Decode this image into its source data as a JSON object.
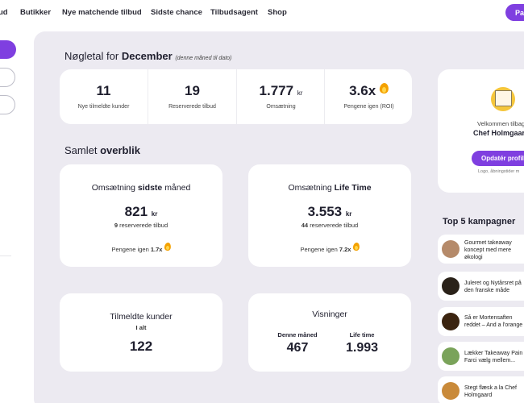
{
  "nav": {
    "items": [
      "ud",
      "Butikker",
      "Nye matchende tilbud",
      "Sidste chance",
      "Tilbudsagent",
      "Shop"
    ],
    "cta_label": "Pa"
  },
  "kpi": {
    "title_prefix": "Nøgletal for",
    "month": "December",
    "note": "(denne måned til dato)",
    "items": [
      {
        "value": "11",
        "unit": "",
        "label": "Nye tilmeldte kunder"
      },
      {
        "value": "19",
        "unit": "",
        "label": "Reserverede tilbud"
      },
      {
        "value": "1.777",
        "unit": "kr",
        "label": "Omsætning"
      },
      {
        "value": "3.6x",
        "unit": "",
        "label": "Pengene igen (ROI)"
      }
    ]
  },
  "overview": {
    "title_prefix": "Samlet",
    "title_bold": "overblik",
    "last_month": {
      "title_prefix": "Omsætning",
      "title_bold": "sidste",
      "title_suffix": "måned",
      "value": "821",
      "unit": "kr",
      "reserved_count": "9",
      "reserved_label": "reserverede tilbud",
      "roi_label": "Pengene igen",
      "roi_value": "1.7x"
    },
    "lifetime": {
      "title_prefix": "Omsætning",
      "title_bold": "Life Time",
      "value": "3.553",
      "unit": "kr",
      "reserved_count": "44",
      "reserved_label": "reserverede tilbud",
      "roi_label": "Pengene igen",
      "roi_value": "7.2x"
    },
    "customers": {
      "title": "Tilmeldte kunder",
      "subtitle": "I alt",
      "value": "122"
    },
    "views": {
      "title": "Visninger",
      "this_month_label": "Denne måned",
      "this_month_value": "467",
      "lifetime_label": "Life time",
      "lifetime_value": "1.993"
    }
  },
  "profile": {
    "welcome": "Velkommen tilbag",
    "name": "Chef Holmgaar",
    "update_button": "Opdatér profil",
    "note": "Logo, åbningstider m"
  },
  "top5": {
    "title": "Top 5 kampagner",
    "items": [
      {
        "line1": "Gourmet takeaway",
        "line2": "koncept med mere",
        "line3": "økologi",
        "thumb_color": "#b58a6a"
      },
      {
        "line1": "Juleret og Nytårsret på",
        "line2": "den franske måde",
        "line3": "",
        "thumb_color": "#2a2219"
      },
      {
        "line1": "Så er Mortensaften",
        "line2": "reddet – And a l'orange",
        "line3": "",
        "thumb_color": "#3b2410"
      },
      {
        "line1": "Lækker Takeaway Pain",
        "line2": "Farci vælg mellem...",
        "line3": "",
        "thumb_color": "#7aa35a"
      },
      {
        "line1": "Stegt flæsk a la Chef",
        "line2": "Holmgaard",
        "line3": "",
        "thumb_color": "#c98a3a"
      }
    ]
  },
  "colors": {
    "accent": "#7f3fe0",
    "panel": "#eceaf1",
    "flame": "#f4a100"
  }
}
